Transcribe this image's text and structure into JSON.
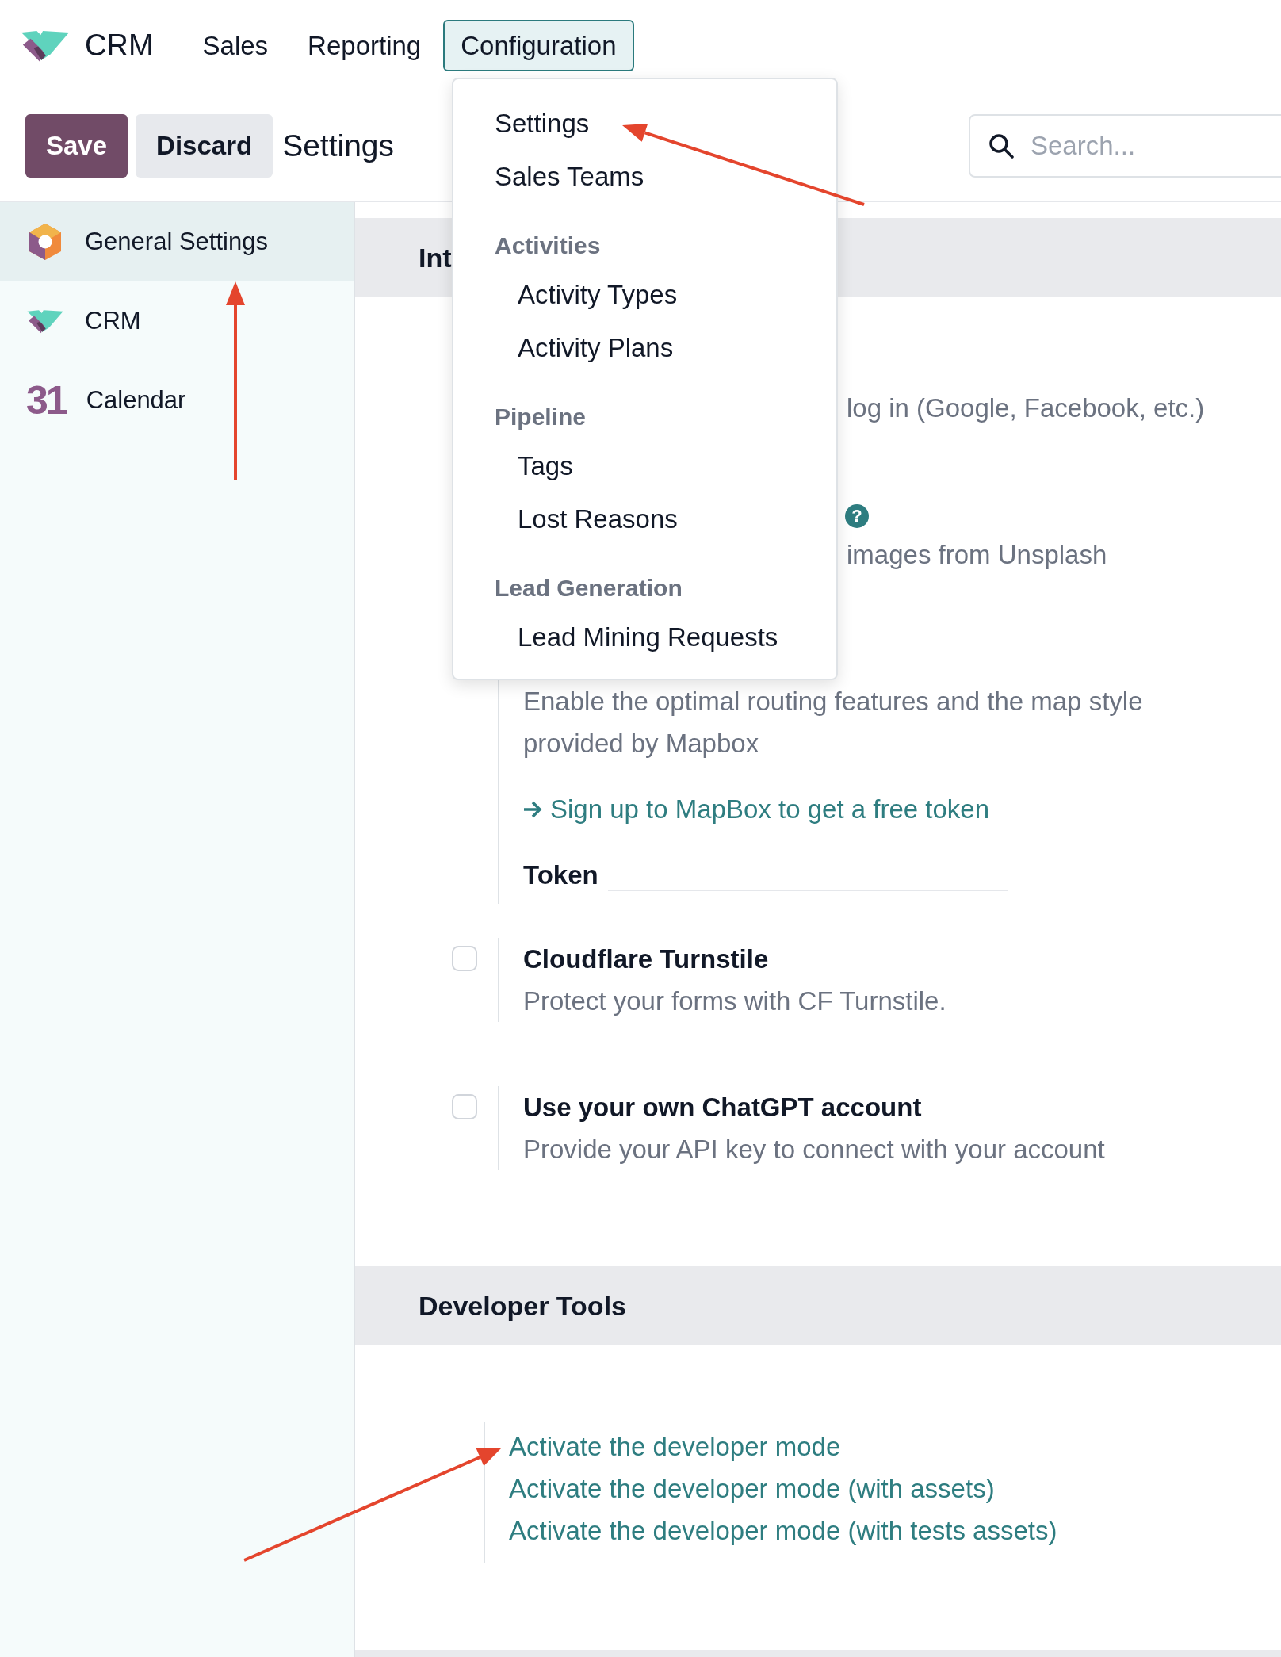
{
  "navbar": {
    "app": "CRM",
    "menus": [
      {
        "label": "Sales",
        "selected": false
      },
      {
        "label": "Reporting",
        "selected": false
      },
      {
        "label": "Configuration",
        "selected": true
      }
    ]
  },
  "control_panel": {
    "buttons": [
      {
        "label": "Save",
        "kind": "primary"
      },
      {
        "label": "Discard",
        "kind": "secondary"
      }
    ],
    "breadcrumb": "Settings",
    "search": {
      "placeholder": "Search..."
    }
  },
  "sidebar": {
    "items": [
      {
        "label": "General Settings",
        "kind": "settings",
        "selected": true
      },
      {
        "label": "CRM",
        "kind": "crm",
        "selected": false
      },
      {
        "label": "Calendar",
        "kind": "calendar",
        "icon_text": "31",
        "selected": false
      }
    ]
  },
  "dropdown": {
    "entries": [
      {
        "kind": "item",
        "label": "Settings"
      },
      {
        "kind": "item",
        "label": "Sales Teams"
      },
      {
        "kind": "header",
        "label": "Activities"
      },
      {
        "kind": "subitem",
        "label": "Activity Types"
      },
      {
        "kind": "subitem",
        "label": "Activity Plans"
      },
      {
        "kind": "header",
        "label": "Pipeline"
      },
      {
        "kind": "subitem",
        "label": "Tags"
      },
      {
        "kind": "subitem",
        "label": "Lost Reasons"
      },
      {
        "kind": "header",
        "label": "Lead Generation"
      },
      {
        "kind": "subitem",
        "label": "Lead Mining Requests"
      }
    ]
  },
  "sections": [
    {
      "title": "Int",
      "settings": [
        {
          "kind": "partial",
          "text": "log in (Google, Facebook, etc.)"
        },
        {
          "kind": "partial",
          "help": "?",
          "text": "images from Unsplash"
        },
        {
          "kind": "mapbox",
          "description": "Enable the optimal routing features and the map style provided by Mapbox",
          "link": "Sign up to MapBox to get a free token",
          "field_label": "Token"
        },
        {
          "kind": "checkbox",
          "title": "Cloudflare Turnstile",
          "description": "Protect your forms with CF Turnstile.",
          "checked": false
        },
        {
          "kind": "checkbox",
          "title": "Use your own ChatGPT account",
          "description": "Provide your API key to connect with your account",
          "checked": false
        }
      ]
    },
    {
      "title": "Developer Tools",
      "links": [
        "Activate the developer mode",
        "Activate the developer mode (with assets)",
        "Activate the developer mode (with tests assets)"
      ]
    }
  ]
}
